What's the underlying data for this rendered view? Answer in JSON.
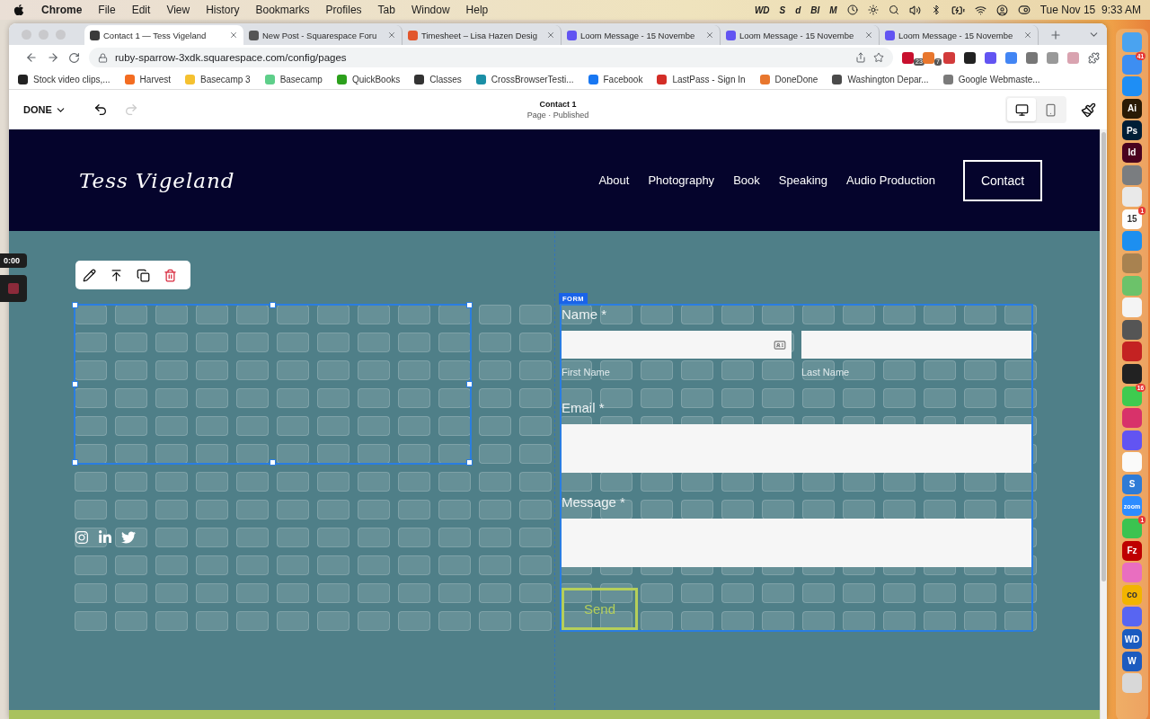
{
  "menu_bar": {
    "app": "Chrome",
    "menus": [
      "File",
      "Edit",
      "View",
      "History",
      "Bookmarks",
      "Profiles",
      "Tab",
      "Window",
      "Help"
    ],
    "status_logos": [
      "WD",
      "S",
      "d",
      "BI",
      "M"
    ],
    "clock": "Tue Nov 15  9:33 AM"
  },
  "browser": {
    "tabs": [
      {
        "title": "Contact 1 — Tess Vigeland",
        "selected": true,
        "color": "#3a3a3a"
      },
      {
        "title": "New Post - Squarespace Foru",
        "selected": false,
        "color": "#555555"
      },
      {
        "title": "Timesheet – Lisa Hazen Desig",
        "selected": false,
        "color": "#e2562d"
      },
      {
        "title": "Loom Message - 15 Novembe",
        "selected": false,
        "color": "#6254f2"
      },
      {
        "title": "Loom Message - 15 Novembe",
        "selected": false,
        "color": "#6254f2"
      },
      {
        "title": "Loom Message - 15 Novembe",
        "selected": false,
        "color": "#6254f2"
      }
    ],
    "address": "ruby-sparrow-3xdk.squarespace.com/config/pages",
    "extensions": [
      {
        "color": "#c8102e",
        "badge": "23"
      },
      {
        "color": "#e8772e",
        "badge": "7"
      },
      {
        "color": "#d23b3b"
      },
      {
        "color": "#222222"
      },
      {
        "color": "#6254f2"
      },
      {
        "color": "#4285f4"
      },
      {
        "color": "#777777"
      },
      {
        "color": "#999999"
      },
      {
        "color": "#d9a3b0"
      }
    ],
    "bookmarks": [
      {
        "title": "Stock video clips,...",
        "color": "#222222"
      },
      {
        "title": "Harvest",
        "color": "#f36c21"
      },
      {
        "title": "Basecamp 3",
        "color": "#f5c130"
      },
      {
        "title": "Basecamp",
        "color": "#5ecf8a"
      },
      {
        "title": "QuickBooks",
        "color": "#2ca01c"
      },
      {
        "title": "Classes",
        "color": "#333333"
      },
      {
        "title": "CrossBrowserTesti...",
        "color": "#1a8fa6"
      },
      {
        "title": "Facebook",
        "color": "#1877f2"
      },
      {
        "title": "LastPass - Sign In",
        "color": "#d32d27"
      },
      {
        "title": "DoneDone",
        "color": "#e8772e"
      },
      {
        "title": "Washington Depar...",
        "color": "#4a4a4a"
      },
      {
        "title": "Google Webmaste...",
        "color": "#7a7a7a"
      }
    ]
  },
  "editor": {
    "done": "DONE",
    "page_title": "Contact 1",
    "page_status": "Page · Published",
    "view_modes": [
      {
        "kind": "desktop",
        "selected": true
      },
      {
        "kind": "mobile",
        "selected": false
      }
    ]
  },
  "site": {
    "logo": "Tess Vigeland",
    "nav": [
      "About",
      "Photography",
      "Book",
      "Speaking",
      "Audio Production"
    ],
    "cta": "Contact",
    "form": {
      "tag": "FORM",
      "name_label": "Name *",
      "first_name_label": "First Name",
      "last_name_label": "Last Name",
      "email_label": "Email *",
      "message_label": "Message *",
      "submit": "Send"
    }
  },
  "recorder": {
    "time": "0:00"
  },
  "dock": [
    {
      "color": "#4aa3f0"
    },
    {
      "color": "#3d8ef2",
      "badge": "41"
    },
    {
      "color": "#1e8ef5"
    },
    {
      "color": "#2a1a05",
      "label": "Ai"
    },
    {
      "color": "#001e36",
      "label": "Ps"
    },
    {
      "color": "#49021f",
      "label": "Id"
    },
    {
      "color": "#7a7d80"
    },
    {
      "color": "#e9e9e9"
    },
    {
      "color": "#fdfdfd",
      "label": "15",
      "badge": "1"
    },
    {
      "color": "#1d8ff0"
    },
    {
      "color": "#a88250"
    },
    {
      "color": "#6cc26a"
    },
    {
      "color": "#f4f4f4"
    },
    {
      "color": "#555555"
    },
    {
      "color": "#c42222"
    },
    {
      "color": "#222222"
    },
    {
      "color": "#3ecb4f",
      "badge": "16"
    },
    {
      "color": "#d8326a"
    },
    {
      "color": "#6254f2"
    },
    {
      "color": "#fafafa"
    },
    {
      "color": "#2e7bd6",
      "label": "S"
    },
    {
      "color": "#2d8cff",
      "label": "zoom"
    },
    {
      "color": "#3bc350",
      "badge": "1"
    },
    {
      "color": "#bf0000",
      "label": "Fz"
    },
    {
      "color": "#e96ec0"
    },
    {
      "color": "#f2b400",
      "label": "co"
    },
    {
      "color": "#5865f2"
    },
    {
      "color": "#1a5bc0",
      "label": "WD"
    },
    {
      "color": "#1d5bbf",
      "label": "W"
    },
    {
      "color": "#d8d8d8"
    }
  ]
}
